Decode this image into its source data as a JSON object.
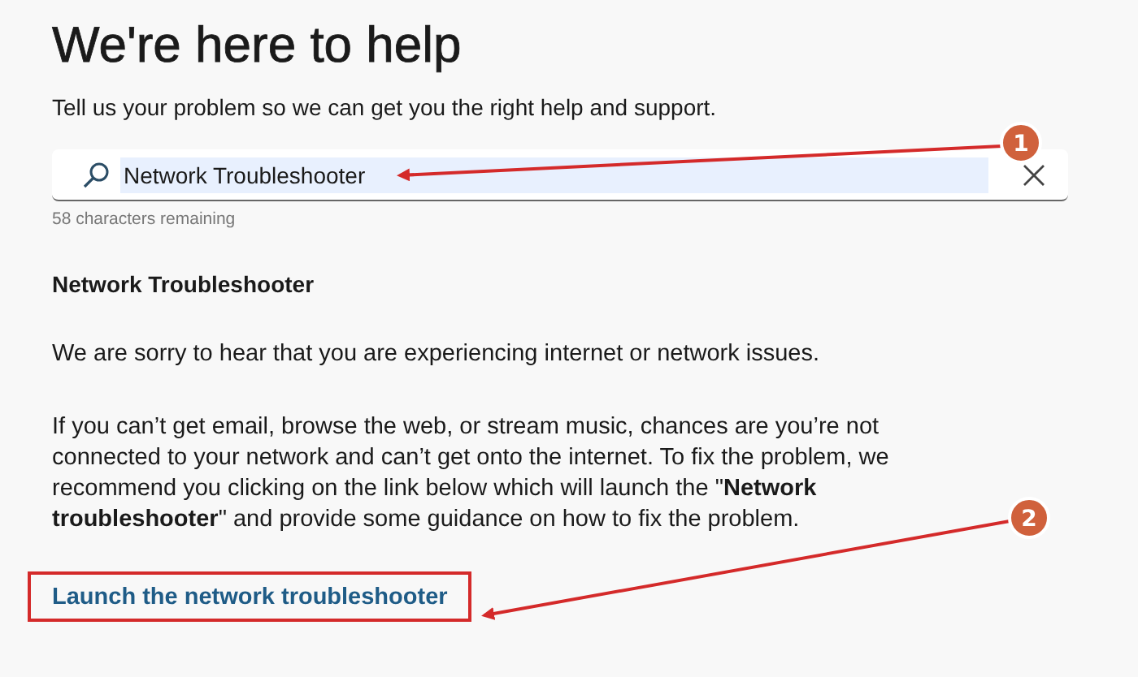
{
  "title": "We're here to help",
  "subtitle": "Tell us your problem so we can get you the right help and support.",
  "search": {
    "value": "Network Troubleshooter"
  },
  "counter": "58 characters remaining",
  "heading": "Network Troubleshooter",
  "paragraphs": [
    "We are sorry to hear that you are experiencing internet or network issues.",
    "If you can’t get email, browse the web, or stream music, chances are you’re not connected to your network and can’t get onto the internet. To fix the problem, we recommend you clicking on the link below which will launch the \"**Network troubleshooter**\" and provide some guidance on how to fix the problem."
  ],
  "link": "Launch the network troubleshooter",
  "annotations": [
    {
      "label": "1"
    },
    {
      "label": "2"
    }
  ]
}
